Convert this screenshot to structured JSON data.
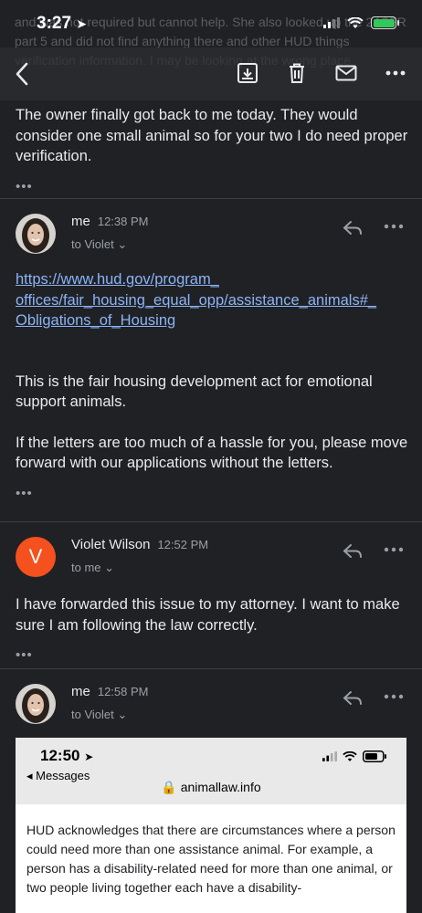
{
  "status": {
    "time": "3:27",
    "location_icon": "location-arrow-icon"
  },
  "background_text": "and was not required but cannot help. She also looked up the 24CFR part 5 and did not find anything there and other HUD things verification information. I may be looking at the wrong place",
  "toolbar": {
    "back_icon": "back-chevron-icon",
    "actions": [
      "archive-icon",
      "trash-icon",
      "mail-icon",
      "more-icon"
    ]
  },
  "messages": [
    {
      "body": "The owner finally got back to me today.  They would consider one small animal so for your two I do need proper verification.",
      "dots": "•••"
    },
    {
      "sender": "me",
      "time": "12:38 PM",
      "to": "to Violet",
      "link": "https://www.hud.gov/program_offices/fair_housing_equal_opp/assistance_animals#_Obligations_of_Housing",
      "link_lines": [
        "https://www.hud.gov/program_",
        "offices/fair_housing_equal_opp/assistance_animals#_",
        "Obligations_of_Housing"
      ],
      "para1": "This is the fair housing development act for emotional support animals.",
      "para2": "If the letters are too much of a hassle for you, please move forward with our applications without the letters.",
      "dots": "•••"
    },
    {
      "sender": "Violet Wilson",
      "initial": "V",
      "time": "12:52 PM",
      "to": "to me",
      "body": "I have forwarded this issue to my attorney.  I want to make sure I am following the law correctly.",
      "dots": "•••"
    },
    {
      "sender": "me",
      "time": "12:58 PM",
      "to": "to Violet"
    }
  ],
  "attachment_screenshot": {
    "time": "12:50",
    "back_label": "◂ Messages",
    "url": "animallaw.info",
    "text": "HUD acknowledges that there are circumstances where a person could need more than one assistance animal. For example, a person has a disability-related need for more than one animal, or two people living together each have a disability-"
  },
  "colors": {
    "background": "#202124",
    "link": "#8ab4f8",
    "avatar_v": "#f4511e",
    "battery": "#34c759"
  }
}
